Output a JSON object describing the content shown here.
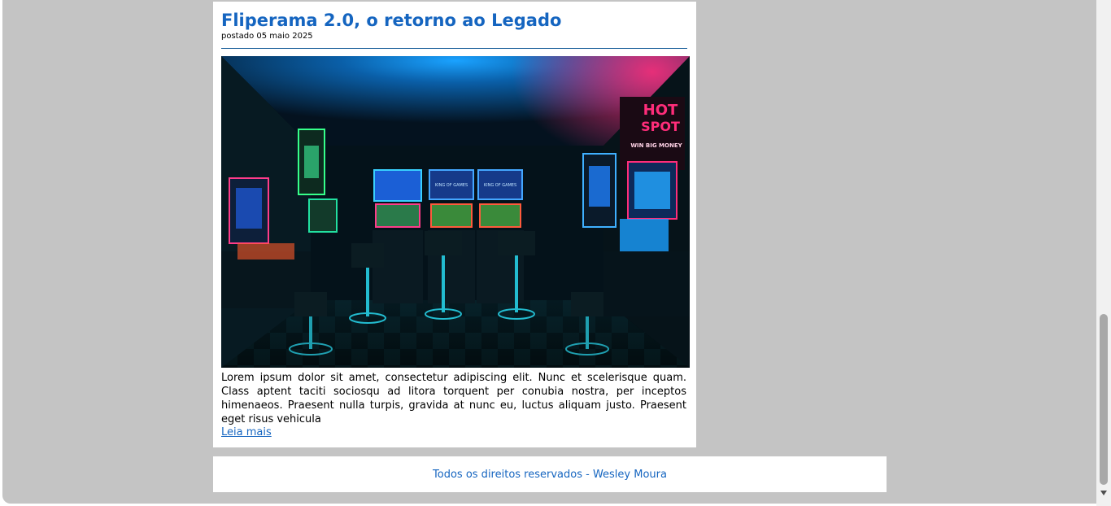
{
  "post": {
    "title": "Fliperama 2.0, o retorno ao Legado",
    "date": "postado 05 maio 2025",
    "image_description": "neon-arcade-photo",
    "excerpt": "Lorem ipsum dolor sit amet, consectetur adipiscing elit. Nunc et scelerisque quam. Class aptent taciti sociosqu ad litora torquent per conubia nostra, per inceptos himenaeos. Praesent nulla turpis, gravida at nunc eu, luctus aliquam justo. Praesent eget risus vehicula",
    "read_more": "Leia mais",
    "photo_signs": {
      "hot_spot_1": "HOT",
      "hot_spot_2": "SPOT",
      "win_big": "WIN BIG MONEY",
      "kings": "KING OF GAMES"
    }
  },
  "footer": {
    "text": "Todos os direitos reservados - Wesley Moura"
  },
  "colors": {
    "page_background": "#c4c4c4",
    "card_background": "#ffffff",
    "link_blue": "#1565c0",
    "divider": "#1a5f9a"
  },
  "icons": {
    "scroll_down": "chevron-down-icon"
  }
}
